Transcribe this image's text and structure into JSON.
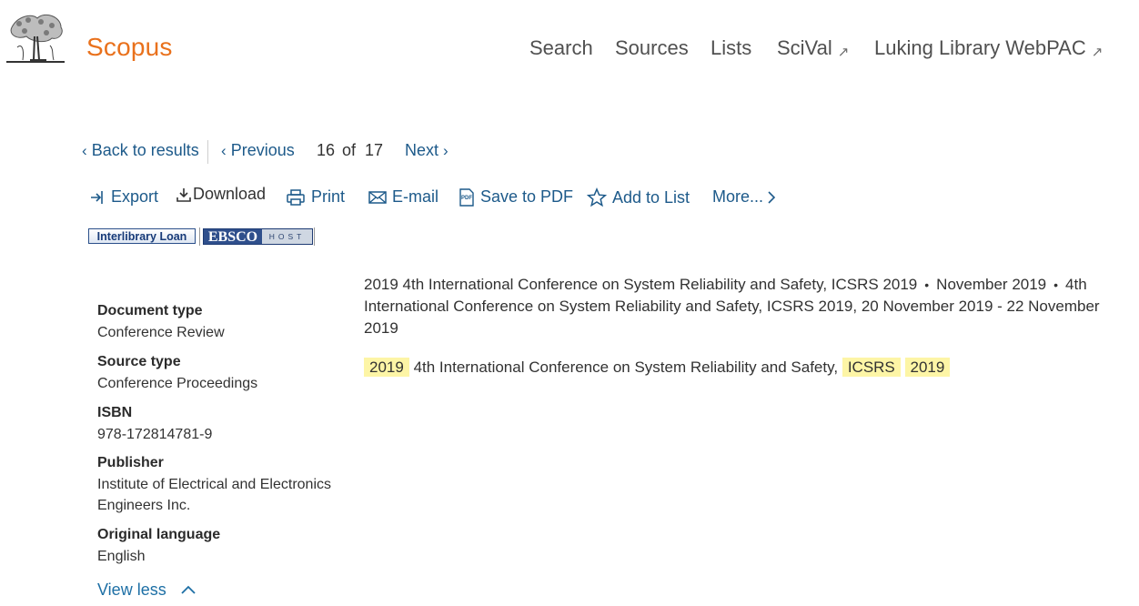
{
  "header": {
    "brand": "Scopus",
    "nav": {
      "search": "Search",
      "sources": "Sources",
      "lists": "Lists",
      "scival": "SciVal",
      "webpac": "Luking Library WebPAC"
    }
  },
  "pager": {
    "back": "Back to results",
    "previous": "Previous",
    "current": "16",
    "of": "of",
    "total": "17",
    "next": "Next"
  },
  "actions": {
    "export": "Export",
    "download": "Download",
    "print": "Print",
    "email": "E-mail",
    "pdf": "Save to PDF",
    "list": "Add to List",
    "more": "More..."
  },
  "badges": {
    "ill": "Interlibrary Loan",
    "ebsco": "EBSCO",
    "host": "HOST"
  },
  "details": {
    "doc_type_label": "Document type",
    "doc_type_value": "Conference Review",
    "source_type_label": "Source type",
    "source_type_value": "Conference Proceedings",
    "isbn_label": "ISBN",
    "isbn_value": "978-172814781-9",
    "publisher_label": "Publisher",
    "publisher_value": "Institute of Electrical and Electronics Engineers Inc.",
    "language_label": "Original language",
    "language_value": "English",
    "view_less": "View less"
  },
  "content": {
    "source_title": "2019 4th International Conference on System Reliability and Safety, ICSRS 2019",
    "source_date": "November 2019",
    "source_event": "4th International Conference on System Reliability and Safety, ICSRS 2019, 20 November 2019 - 22 November 2019",
    "doc_title": {
      "part1": "2019",
      "part2": "4th International Conference on System Reliability and Safety,",
      "part3": "ICSRS",
      "part4": "2019"
    }
  }
}
